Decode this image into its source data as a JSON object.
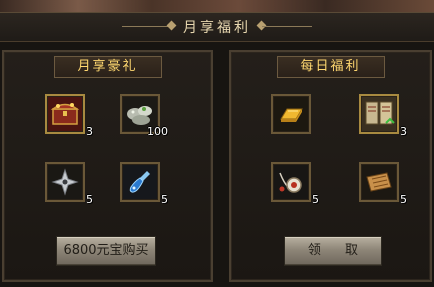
{
  "window": {
    "title": "月享福利"
  },
  "monthly_panel": {
    "header": "月享豪礼",
    "items": [
      {
        "icon": "treasure-chest-icon",
        "count": "3"
      },
      {
        "icon": "silver-ore-icon",
        "count": "100"
      },
      {
        "icon": "shuriken-icon",
        "count": "5"
      },
      {
        "icon": "blue-potion-icon",
        "count": "5"
      }
    ],
    "buy_button": "6800元宝购买"
  },
  "daily_panel": {
    "header": "每日福利",
    "items": [
      {
        "icon": "gold-bar-icon",
        "count": ""
      },
      {
        "icon": "skill-book-icon",
        "count": "3"
      },
      {
        "icon": "amulet-icon",
        "count": "5"
      },
      {
        "icon": "scroll-icon",
        "count": "5"
      }
    ],
    "claim_button": "领 取"
  },
  "colors": {
    "accent_gold": "#ffd870",
    "frame": "#6a5838",
    "background": "#171411"
  }
}
